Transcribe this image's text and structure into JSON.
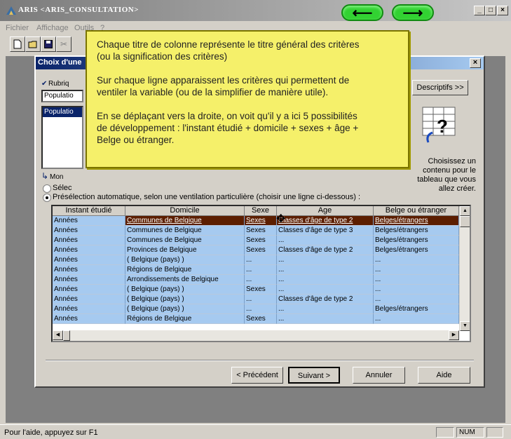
{
  "app": {
    "title": "ARIS <ARIS_CONSULTATION>",
    "menu": [
      "Fichier",
      "Affichage",
      "Outils",
      "?"
    ],
    "toolbar_cut_glyph": "✂"
  },
  "dialog": {
    "title": "Choix d'une",
    "close_glyph": "×",
    "rubric_label": "Rubriq",
    "rubric_value": "Populatio",
    "rubric_list_item": "Populatio",
    "mon_label": "Mon",
    "select_radio_label": "Sélec",
    "preselect_label": "Présélection automatique, selon une ventilation particulière (choisir une ligne ci-dessous) :",
    "descriptifs_button": "Descriptifs >>",
    "choose_text": "Choisissez un\ncontenu pour le\ntableau que vous\nallez créer.",
    "buttons": {
      "previous": "< Précédent",
      "next": "Suivant >",
      "cancel": "Annuler",
      "help": "Aide"
    }
  },
  "grid": {
    "columns": [
      "Instant étudié",
      "Domicile",
      "Sexe",
      "Age",
      "Belge ou étranger"
    ],
    "rows": [
      [
        "Années",
        "Communes de Belgique",
        "Sexes",
        "Classes d'âge de type 2",
        "Belges/étrangers"
      ],
      [
        "Années",
        "Communes de Belgique",
        "Sexes",
        "Classes d'âge de type 3",
        "Belges/étrangers"
      ],
      [
        "Années",
        "Communes de Belgique",
        "Sexes",
        "...",
        "Belges/étrangers"
      ],
      [
        "Années",
        "Provinces de Belgique",
        "Sexes",
        "Classes d'âge de type 2",
        "Belges/étrangers"
      ],
      [
        "Années",
        "( Belgique (pays) )",
        "...",
        "...",
        "..."
      ],
      [
        "Années",
        "Régions de Belgique",
        "...",
        "...",
        "..."
      ],
      [
        "Années",
        "Arrondissements de Belgique",
        "...",
        "...",
        "..."
      ],
      [
        "Années",
        "( Belgique (pays) )",
        "Sexes",
        "...",
        "..."
      ],
      [
        "Années",
        "( Belgique (pays) )",
        "...",
        "Classes d'âge de type 2",
        "..."
      ],
      [
        "Années",
        "( Belgique (pays) )",
        "...",
        "...",
        "Belges/étrangers"
      ],
      [
        "Années",
        "Régions de Belgique",
        "Sexes",
        "...",
        "..."
      ]
    ],
    "selected_row": 0
  },
  "tooltip": {
    "paragraphs": [
      "Chaque titre de colonne représente le titre général des critères\n(ou la signification des critères)",
      " Sur chaque ligne apparaissent les critères qui permettent de\nventiler la variable (ou de la simplifier de manière utile).",
      "En se déplaçant vers la droite, on voit qu'il y a ici 5 possibilités\nde développement : l'instant étudié + domicile + sexes + âge +\nBelge ou étranger."
    ]
  },
  "status": {
    "help_text": "Pour l'aide, appuyez sur F1",
    "num": "NUM"
  },
  "colors": {
    "tooltip_bg": "#f5f06a",
    "selected_row": "#5c1e00",
    "row_bg": "#a6caf0",
    "nav_arrow": "#32d232"
  }
}
